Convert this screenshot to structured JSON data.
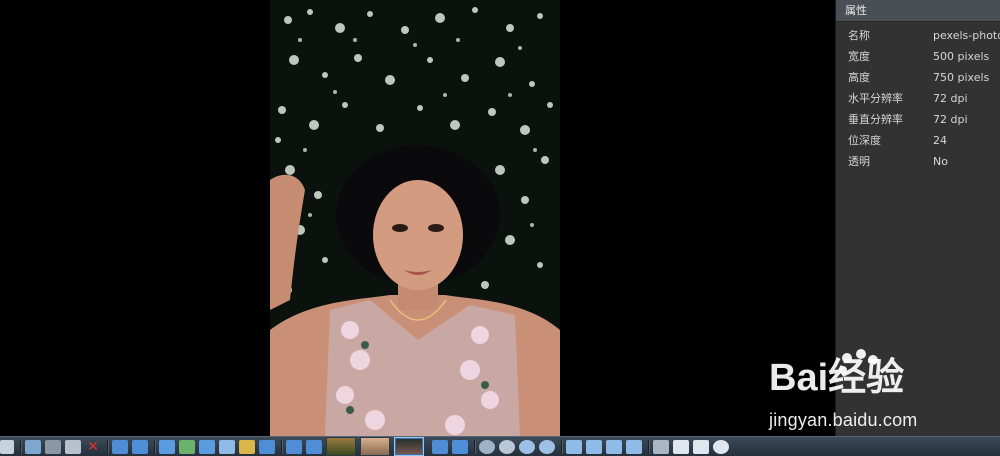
{
  "panel": {
    "title": "属性",
    "properties": [
      {
        "key": "名称",
        "value": "pexels-photo"
      },
      {
        "key": "宽度",
        "value": "500 pixels"
      },
      {
        "key": "高度",
        "value": "750 pixels"
      },
      {
        "key": "水平分辨率",
        "value": "72 dpi"
      },
      {
        "key": "垂直分辨率",
        "value": "72 dpi"
      },
      {
        "key": "位深度",
        "value": "24"
      },
      {
        "key": "透明",
        "value": "No"
      }
    ]
  },
  "watermark": {
    "logo_text": "Bai经验",
    "url": "jingyan.baidu.com"
  },
  "toolbar": {
    "icons": [
      "exit-icon",
      "open-icon",
      "save-icon",
      "print-icon",
      "delete-icon",
      "rotate-left-icon",
      "rotate-right-icon",
      "crop-icon",
      "adjust-color-icon",
      "resize-icon",
      "edit-icon",
      "send-icon",
      "first-image-icon",
      "previous-image-icon",
      "next-image-icon",
      "last-image-icon",
      "settings-icon",
      "zoom-out-icon",
      "zoom-in-icon",
      "fit-icon",
      "actual-size-icon",
      "fullscreen-icon",
      "slideshow-icon",
      "properties-icon",
      "view-icon"
    ]
  },
  "colors": {
    "panel_bg": "#323232",
    "panel_header_bg": "#4a4f55",
    "toolbar_bg": "#2c3846",
    "viewer_bg": "#000000"
  }
}
